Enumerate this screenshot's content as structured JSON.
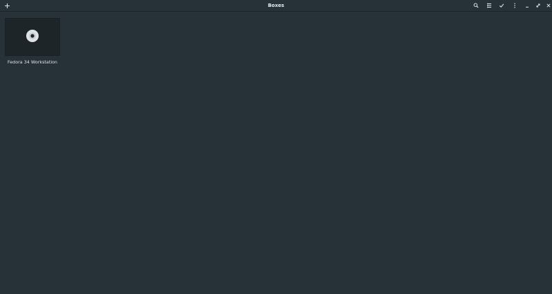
{
  "app": {
    "title": "Boxes"
  },
  "toolbar": {
    "new_icon": "plus-icon",
    "right_icons": [
      "search-icon",
      "list-view-icon",
      "select-check-icon",
      "menu-kebab-icon",
      "minimize-icon",
      "maximize-icon",
      "close-icon"
    ]
  },
  "vms": [
    {
      "name": "Fedora 34 Workstation",
      "icon": "disc-icon"
    }
  ],
  "colors": {
    "background": "#263238",
    "thumbnail": "#1e2528",
    "text": "#dfe3e6"
  }
}
